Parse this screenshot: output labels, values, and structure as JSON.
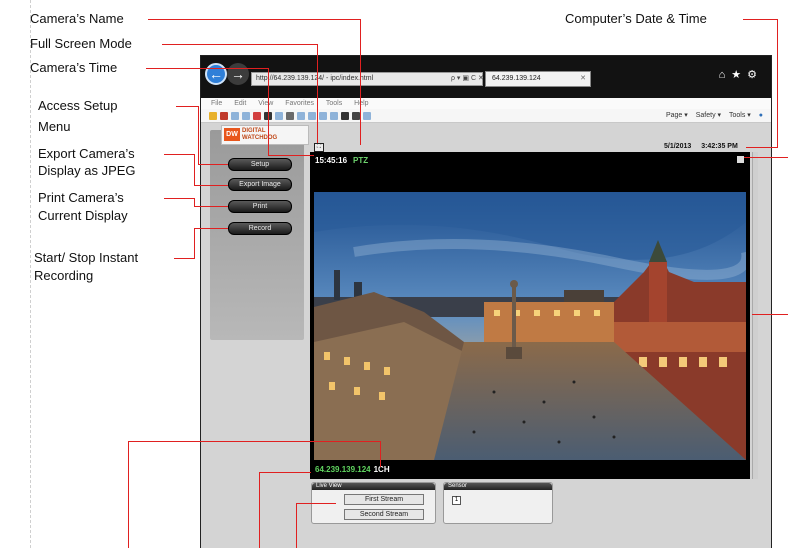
{
  "annotations": {
    "camera_name": "Camera’s Name",
    "full_screen": "Full Screen Mode",
    "camera_time": "Camera’s Time",
    "access_setup_1": "Access Setup",
    "access_setup_2": "Menu",
    "export_1": "Export Camera’s",
    "export_2": "Display as JPEG",
    "print_1": "Print Camera’s",
    "print_2": "Current Display",
    "record_1": "Start/ Stop Instant",
    "record_2": "Recording",
    "computer_time": "Computer’s Date & Time"
  },
  "browser": {
    "address": "http://64.239.139.124/ - ipc/index.html",
    "address_tools": "ρ ▾ ▣ C ✕",
    "tab_title": "64.239.139.124",
    "menu": [
      "File",
      "Edit",
      "View",
      "Favorites",
      "Tools",
      "Help"
    ],
    "commands": [
      "Page ▾",
      "Safety ▾",
      "Tools ▾"
    ]
  },
  "app": {
    "logo_mark": "DW",
    "logo_text_1": "DIGITAL",
    "logo_text_2": "WATCHDOG",
    "buttons": {
      "setup": "Setup",
      "export": "Export Image",
      "print": "Print",
      "record": "Record"
    },
    "date": "5/1/2013",
    "time": "3:42:35 PM",
    "camera_time": "15:45:16",
    "ptz": "PTZ",
    "camera_ip": "64.239.139.124",
    "channel": "1CH",
    "live_view": {
      "title": "Live View",
      "first": "First Stream",
      "second": "Second Stream"
    },
    "sensor": {
      "title": "Sensor",
      "number": "1"
    }
  },
  "colors": {
    "annotation_line": "#e02020",
    "ptz_green": "#6ed36e",
    "accent_orange": "#e8561c"
  }
}
